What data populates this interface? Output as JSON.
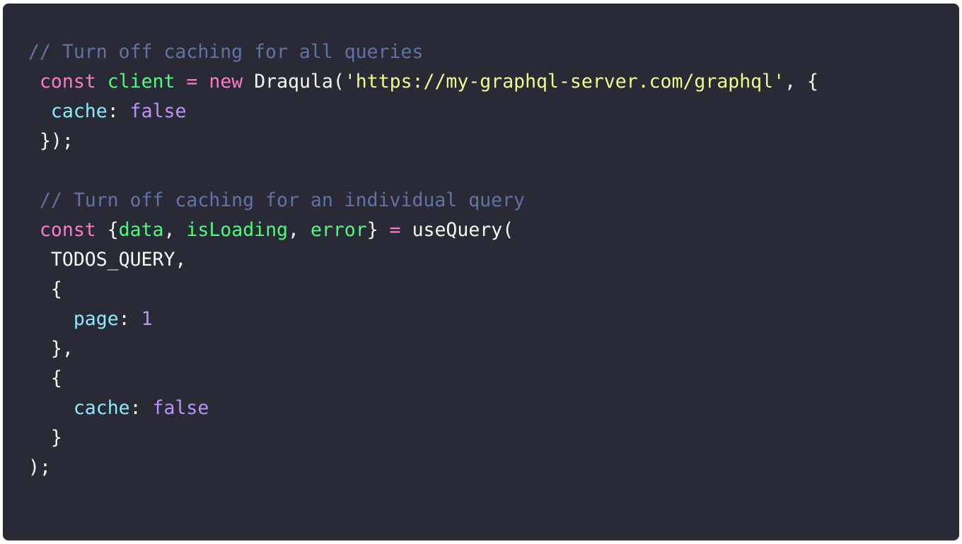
{
  "code": {
    "lines": [
      [
        {
          "t": "// Turn off caching for all queries",
          "k": "comment"
        }
      ],
      [
        {
          "t": " ",
          "k": "plain"
        },
        {
          "t": "const",
          "k": "keyword"
        },
        {
          "t": " ",
          "k": "plain"
        },
        {
          "t": "client",
          "k": "ident"
        },
        {
          "t": " ",
          "k": "plain"
        },
        {
          "t": "=",
          "k": "keyword"
        },
        {
          "t": " ",
          "k": "plain"
        },
        {
          "t": "new",
          "k": "keyword"
        },
        {
          "t": " Draqula(",
          "k": "plain"
        },
        {
          "t": "'https://my-graphql-server.com/graphql'",
          "k": "string"
        },
        {
          "t": ", {",
          "k": "plain"
        }
      ],
      [
        {
          "t": "  ",
          "k": "plain"
        },
        {
          "t": "cache",
          "k": "prop"
        },
        {
          "t": ": ",
          "k": "plain"
        },
        {
          "t": "false",
          "k": "literal"
        }
      ],
      [
        {
          "t": " });",
          "k": "plain"
        }
      ],
      [
        {
          "t": "",
          "k": "plain"
        }
      ],
      [
        {
          "t": " // Turn off caching for an individual query",
          "k": "comment"
        }
      ],
      [
        {
          "t": " ",
          "k": "plain"
        },
        {
          "t": "const",
          "k": "keyword"
        },
        {
          "t": " {",
          "k": "plain"
        },
        {
          "t": "data",
          "k": "ident"
        },
        {
          "t": ", ",
          "k": "plain"
        },
        {
          "t": "isLoading",
          "k": "ident"
        },
        {
          "t": ", ",
          "k": "plain"
        },
        {
          "t": "error",
          "k": "ident"
        },
        {
          "t": "} ",
          "k": "plain"
        },
        {
          "t": "=",
          "k": "keyword"
        },
        {
          "t": " useQuery(",
          "k": "plain"
        }
      ],
      [
        {
          "t": "  TODOS_QUERY,",
          "k": "plain"
        }
      ],
      [
        {
          "t": "  {",
          "k": "plain"
        }
      ],
      [
        {
          "t": "    ",
          "k": "plain"
        },
        {
          "t": "page",
          "k": "prop"
        },
        {
          "t": ": ",
          "k": "plain"
        },
        {
          "t": "1",
          "k": "literal"
        }
      ],
      [
        {
          "t": "  },",
          "k": "plain"
        }
      ],
      [
        {
          "t": "  {",
          "k": "plain"
        }
      ],
      [
        {
          "t": "    ",
          "k": "plain"
        },
        {
          "t": "cache",
          "k": "prop"
        },
        {
          "t": ": ",
          "k": "plain"
        },
        {
          "t": "false",
          "k": "literal"
        }
      ],
      [
        {
          "t": "  }",
          "k": "plain"
        }
      ],
      [
        {
          "t": ");",
          "k": "plain"
        }
      ]
    ]
  },
  "theme": {
    "background": "#282a36",
    "comment": "#6272a4",
    "keyword": "#ff79c6",
    "ident": "#50fa7b",
    "string": "#f1fa8c",
    "prop": "#8be9fd",
    "literal": "#bd93f9",
    "plain": "#f8f8f2"
  }
}
